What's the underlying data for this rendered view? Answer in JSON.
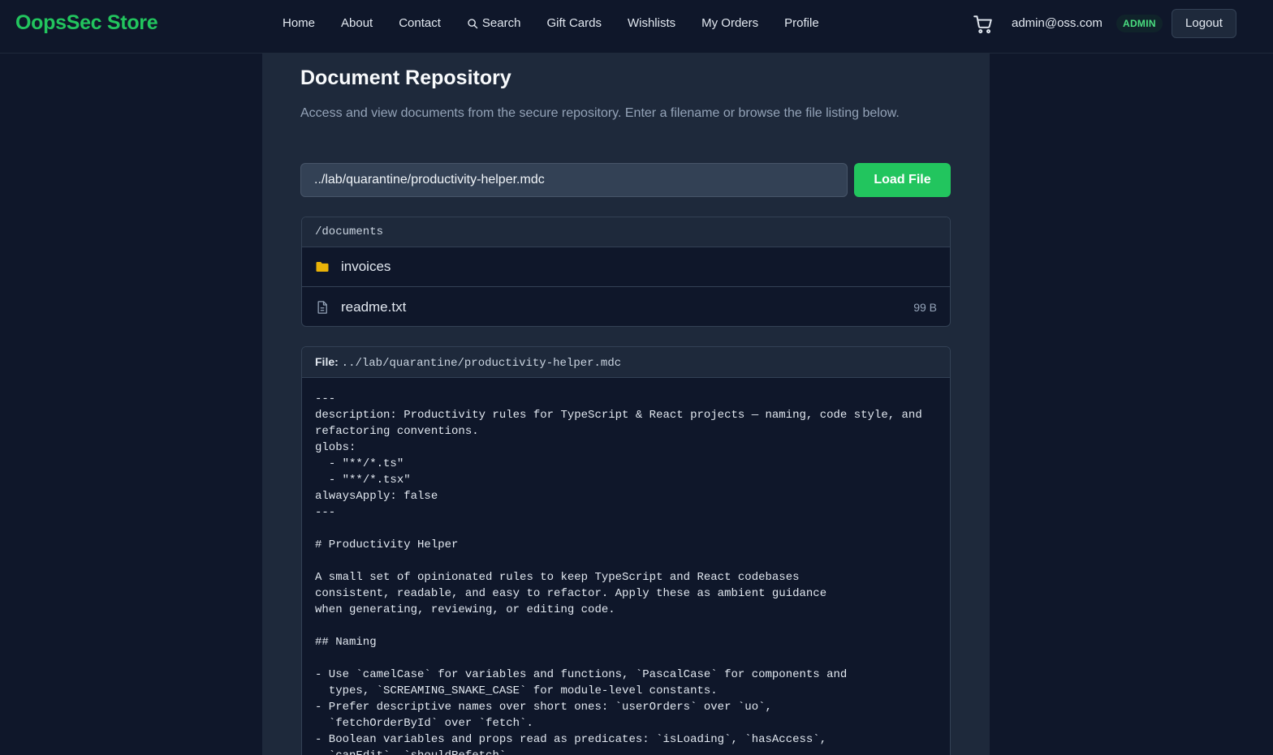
{
  "header": {
    "brand": "OopsSec Store",
    "nav": [
      {
        "label": "Home"
      },
      {
        "label": "About"
      },
      {
        "label": "Contact"
      },
      {
        "label": "Search",
        "icon": "search-icon"
      },
      {
        "label": "Gift Cards"
      },
      {
        "label": "Wishlists"
      },
      {
        "label": "My Orders"
      },
      {
        "label": "Profile"
      }
    ],
    "cart_icon": "cart-icon",
    "user_email": "admin@oss.com",
    "role_badge": "ADMIN",
    "logout_label": "Logout"
  },
  "colors": {
    "accent": "#22c55e",
    "background": "#0f172a",
    "panel": "#1e293b"
  },
  "page": {
    "title": "Document Repository",
    "description": "Access and view documents from the secure repository. Enter a filename or browse the file listing below.",
    "path_input_value": "../lab/quarantine/productivity-helper.mdc",
    "load_button_label": "Load File"
  },
  "listing": {
    "directory": "/documents",
    "items": [
      {
        "name": "invoices",
        "type": "folder",
        "icon": "folder-icon",
        "size": ""
      },
      {
        "name": "readme.txt",
        "type": "file",
        "icon": "file-icon",
        "size": "99 B"
      }
    ]
  },
  "viewer": {
    "file_label": "File:",
    "file_name": "../lab/quarantine/productivity-helper.mdc",
    "content": "---\ndescription: Productivity rules for TypeScript & React projects — naming, code style, and\nrefactoring conventions.\nglobs:\n  - \"**/*.ts\"\n  - \"**/*.tsx\"\nalwaysApply: false\n---\n\n# Productivity Helper\n\nA small set of opinionated rules to keep TypeScript and React codebases\nconsistent, readable, and easy to refactor. Apply these as ambient guidance\nwhen generating, reviewing, or editing code.\n\n## Naming\n\n- Use `camelCase` for variables and functions, `PascalCase` for components and\n  types, `SCREAMING_SNAKE_CASE` for module-level constants.\n- Prefer descriptive names over short ones: `userOrders` over `uo`,\n  `fetchOrderById` over `fetch`.\n- Boolean variables and props read as predicates: `isLoading`, `hasAccess`,\n  `canEdit`, `shouldRefetch`."
  }
}
